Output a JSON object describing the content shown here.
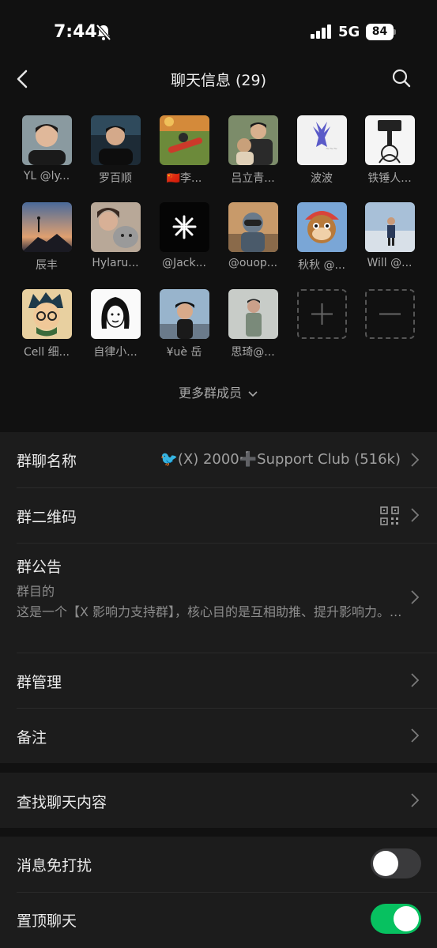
{
  "status": {
    "time": "7:44",
    "network": "5G",
    "battery": "84"
  },
  "nav": {
    "title": "聊天信息 (29)"
  },
  "members": [
    {
      "name": "YL @ly..."
    },
    {
      "name": "罗百顺"
    },
    {
      "name": "🇨🇳李..."
    },
    {
      "name": "吕立青..."
    },
    {
      "name": "波波"
    },
    {
      "name": "铁锤人..."
    },
    {
      "name": "辰丰"
    },
    {
      "name": "Hylaru..."
    },
    {
      "name": "@Jack..."
    },
    {
      "name": "@ouop..."
    },
    {
      "name": "秋秋 @..."
    },
    {
      "name": "Will @..."
    },
    {
      "name": "Cell 细..."
    },
    {
      "name": "自律小..."
    },
    {
      "name": "¥uè 岳"
    },
    {
      "name": "思琦@..."
    }
  ],
  "more_members": "更多群成员",
  "settings": {
    "group_name_label": "群聊名称",
    "group_name_value": "🐦(X) 2000➕Support Club (516k)",
    "qr_label": "群二维码",
    "announcement_label": "群公告",
    "announcement_sub": "群目的",
    "announcement_body": "这是一个【X 影响力支持群】，核心目的是互相助推、提升影响力。...",
    "manage_label": "群管理",
    "remark_label": "备注",
    "search_label": "查找聊天内容",
    "mute_label": "消息免打扰",
    "mute_on": false,
    "pin_label": "置顶聊天",
    "pin_on": true
  },
  "colors": {
    "toggle_on": "#07c160",
    "toggle_off": "#3a3a3c",
    "background": "#111111",
    "cell": "#1c1c1c"
  }
}
